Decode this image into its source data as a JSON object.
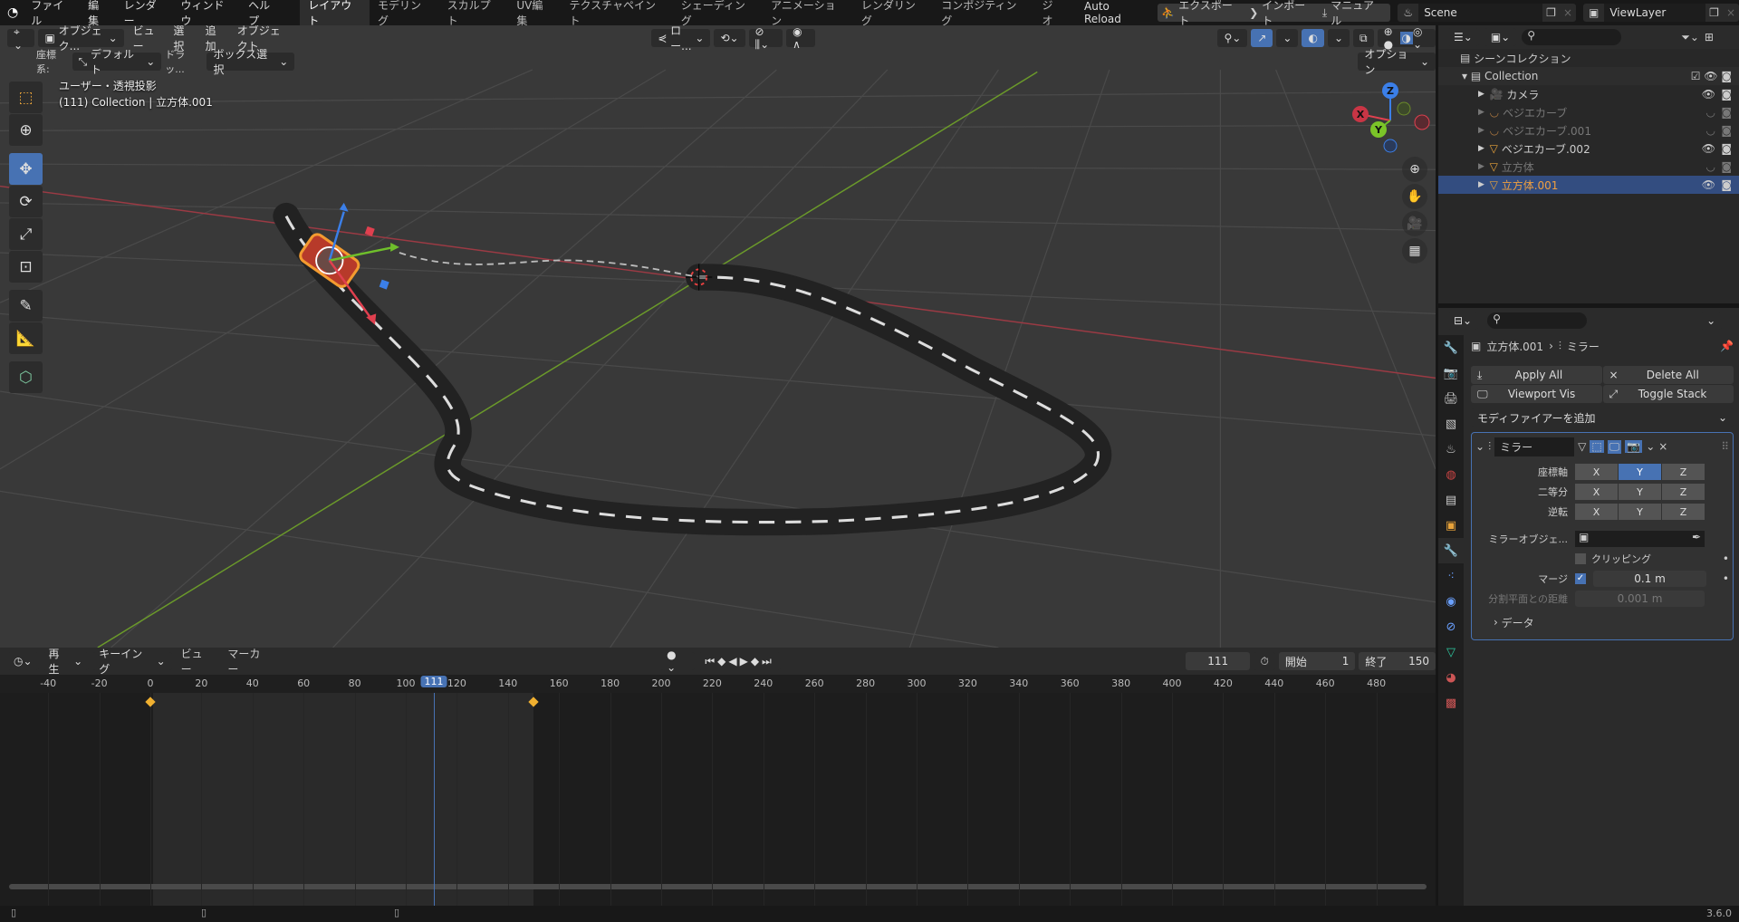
{
  "topbar": {
    "menus": [
      "ファイル",
      "編集",
      "レンダー",
      "ウィンドウ",
      "ヘルプ"
    ],
    "workspaces": [
      "レイアウト",
      "モデリング",
      "スカルプト",
      "UV編集",
      "テクスチャペイント",
      "シェーディング",
      "アニメーション",
      "レンダリング",
      "コンポジティング",
      "ジオ"
    ],
    "active_workspace": 0,
    "auto_reload": "Auto Reload",
    "export": "エクスポート",
    "import": "インポート",
    "manual": "マニュアル",
    "scene": "Scene",
    "view_layer": "ViewLayer"
  },
  "viewport": {
    "mode": "オブジェク...",
    "menus": [
      "ビュー",
      "選択",
      "追加",
      "オブジェクト"
    ],
    "pivot": "ロー...",
    "coord_label": "座標系:",
    "coord_value": "デフォルト",
    "drag_label": "ドラッ...",
    "drag_value": "ボックス選択",
    "options": "オプション",
    "overlay_line1": "ユーザー・透視投影",
    "overlay_line2": "(111) Collection | 立方体.001",
    "active_tool": "move",
    "colors": {
      "x_axis": "#9b3a44",
      "y_axis": "#6b9a2a",
      "accent": "#4772b3"
    }
  },
  "timeline": {
    "menus": [
      "再生",
      "キーイング",
      "ビュー",
      "マーカー"
    ],
    "current_frame": "111",
    "start_label": "開始",
    "start": "1",
    "end_label": "終了",
    "end": "150",
    "ticks": [
      "-40",
      "-20",
      "0",
      "20",
      "40",
      "60",
      "80",
      "100",
      "120",
      "140",
      "160",
      "180",
      "200",
      "220",
      "240",
      "260",
      "280",
      "300",
      "320",
      "340",
      "360",
      "380",
      "400",
      "420",
      "440",
      "460",
      "480"
    ],
    "keyframes": [
      0,
      150
    ]
  },
  "outliner": {
    "root": "シーンコレクション",
    "collection": "Collection",
    "items": [
      {
        "name": "カメラ",
        "type": "camera",
        "visible": true
      },
      {
        "name": "ベジエカーブ",
        "type": "curve",
        "visible": false
      },
      {
        "name": "ベジエカーブ.001",
        "type": "curve",
        "visible": false
      },
      {
        "name": "ベジエカーブ.002",
        "type": "mesh",
        "visible": true
      },
      {
        "name": "立方体",
        "type": "mesh",
        "visible": false
      },
      {
        "name": "立方体.001",
        "type": "mesh",
        "visible": true,
        "selected": true
      }
    ]
  },
  "properties": {
    "breadcrumb_object": "立方体.001",
    "breadcrumb_modifier": "ミラー",
    "apply_all": "Apply All",
    "delete_all": "Delete All",
    "viewport_vis": "Viewport Vis",
    "toggle_stack": "Toggle Stack",
    "add_modifier": "モディファイアーを追加",
    "modifier": {
      "name": "ミラー",
      "axis_label": "座標軸",
      "bisect_label": "二等分",
      "flip_label": "逆転",
      "axes": [
        "X",
        "Y",
        "Z"
      ],
      "axis_active": "Y",
      "mirror_object_label": "ミラーオブジェ...",
      "clipping": "クリッピング",
      "clipping_on": false,
      "merge_label": "マージ",
      "merge_on": true,
      "merge_value": "0.1 m",
      "bisect_distance_label": "分割平面との距離",
      "bisect_distance": "0.001 m",
      "data_panel": "データ"
    }
  },
  "status": {
    "version": "3.6.0"
  }
}
